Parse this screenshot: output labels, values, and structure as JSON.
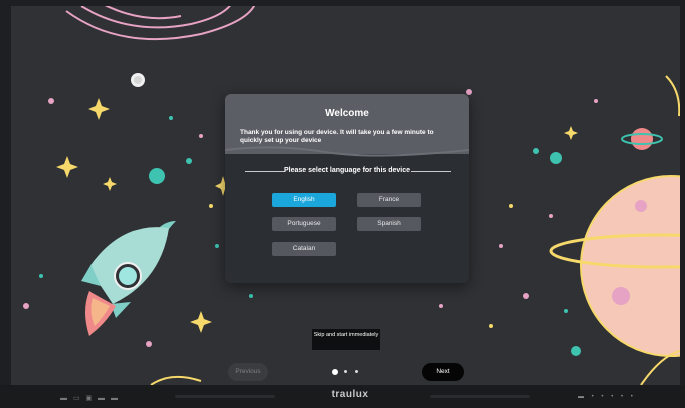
{
  "dialog": {
    "title": "Welcome",
    "subtitle": "Thank you for using our device. It will take you a few minute to quickly set up your device",
    "language_prompt": "Please select language for this device"
  },
  "languages": [
    {
      "label": "English",
      "selected": true
    },
    {
      "label": "France",
      "selected": false
    },
    {
      "label": "Portuguese",
      "selected": false
    },
    {
      "label": "Spanish",
      "selected": false
    },
    {
      "label": "Catalan",
      "selected": false
    }
  ],
  "footer": {
    "skip_label": "Skip and start immediately",
    "previous_label": "Previous",
    "next_label": "Next",
    "page_indicator": {
      "total": 3,
      "current": 1
    }
  },
  "bezel": {
    "brand": "traulux"
  },
  "colors": {
    "accent": "#1ba7dc",
    "dialog_bg": "#2b2e33",
    "dialog_header": "#5b5e64",
    "background": "#2f3135"
  }
}
